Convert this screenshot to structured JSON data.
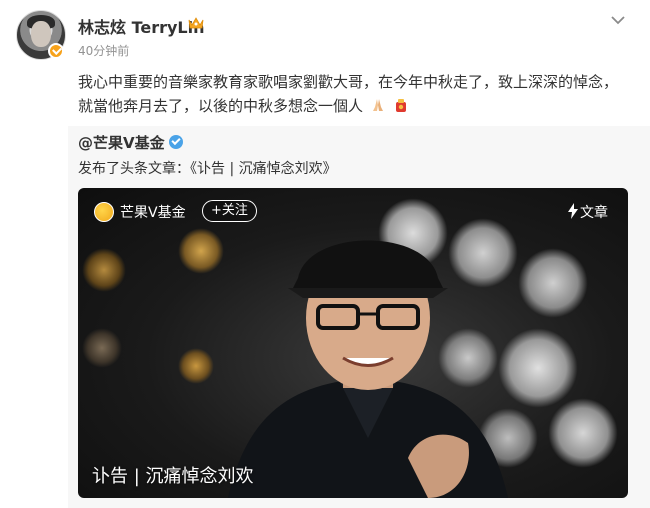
{
  "post": {
    "username": "林志炫 TerryLin",
    "timestamp": "40分钟前",
    "body_line1": "我心中重要的音樂家教育家歌唱家劉歡大哥，在今年中秋走了，致上深深的悼念，",
    "body_line2": "就當他奔月去了，以後的中秋多想念一個人"
  },
  "repost": {
    "author": "@芒果V基金",
    "text": "发布了头条文章：《讣告 | 沉痛悼念刘欢》",
    "card": {
      "account": "芒果V基金",
      "follow_label": "+关注",
      "article_tag": "文章",
      "title": "讣告 | 沉痛悼念刘欢"
    }
  },
  "icons": {
    "verified_badge": "orange-v-badge",
    "crown": "crown-icon",
    "menu": "chevron-down-icon",
    "repost_verified": "blue-v-badge",
    "article": "lightning-icon"
  },
  "colors": {
    "username": "#333333",
    "timestamp": "#939393",
    "repost_bg": "#f7f7f7",
    "verified_orange": "#f7a21b",
    "verified_blue": "#4aa3e8"
  }
}
